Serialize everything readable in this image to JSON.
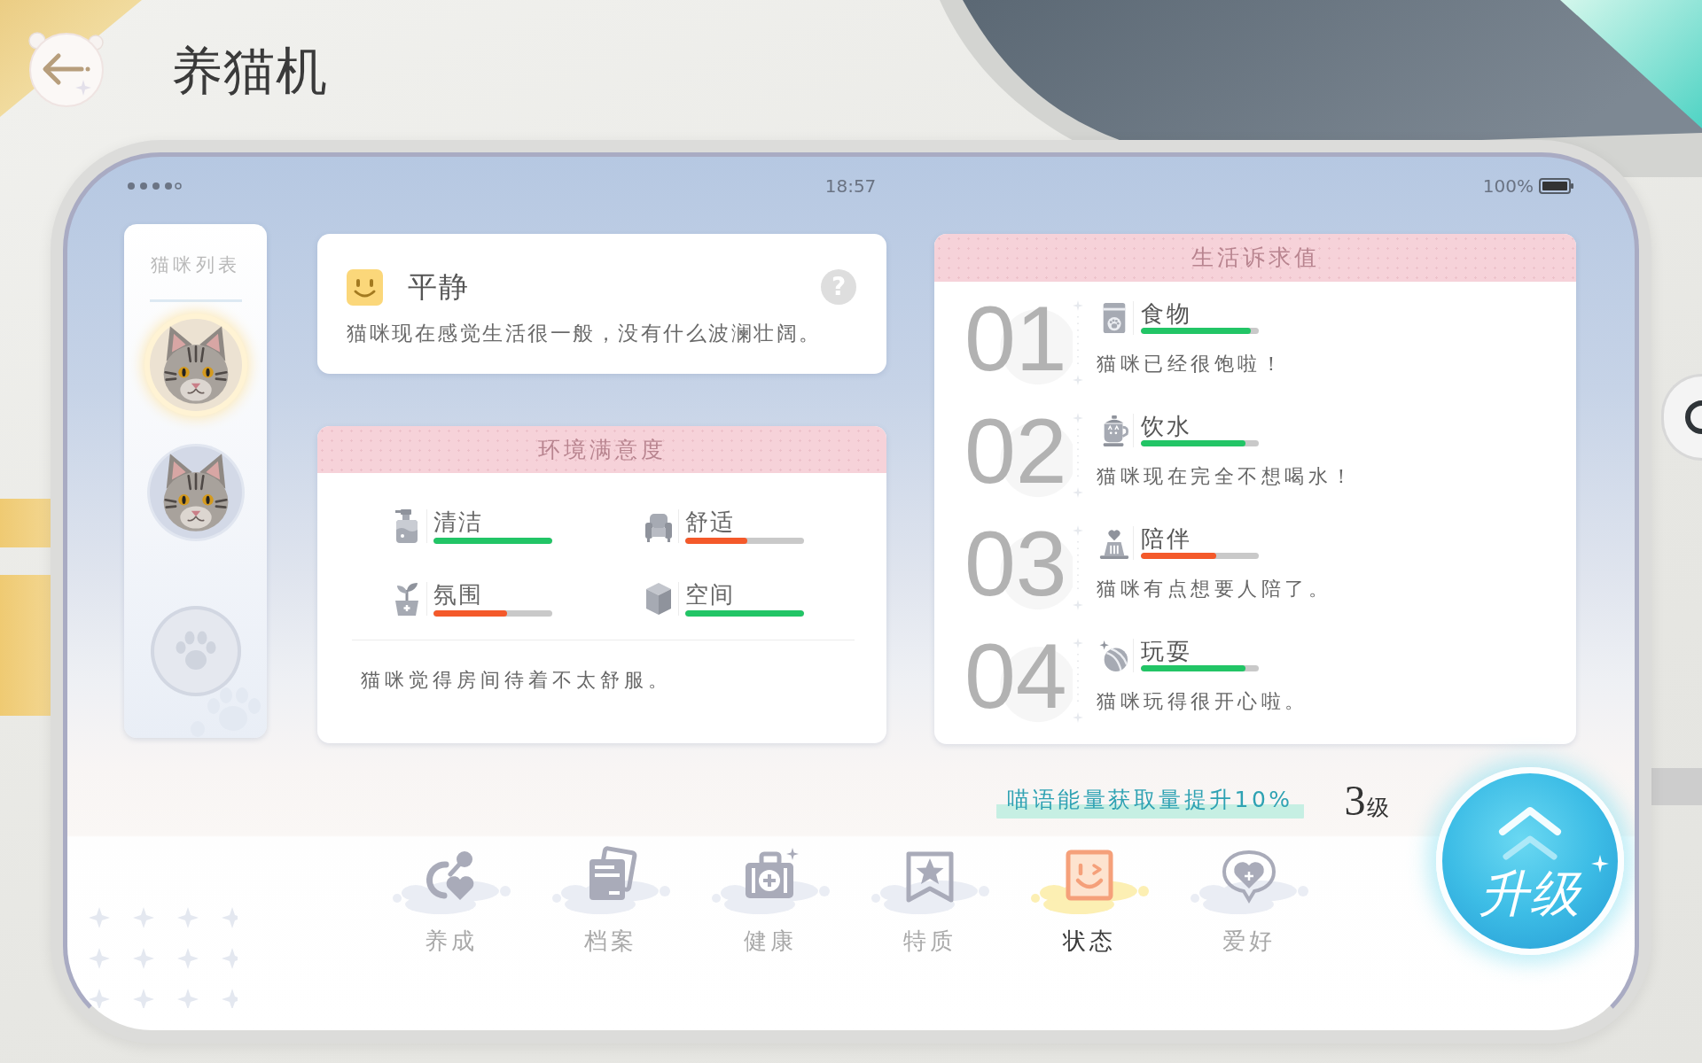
{
  "title": "养猫机",
  "status_bar": {
    "time": "18:57",
    "battery": "100%"
  },
  "cat_list": {
    "title": "猫咪列表",
    "slots": [
      {
        "kind": "cat",
        "selected": true
      },
      {
        "kind": "cat",
        "selected": false
      },
      {
        "kind": "empty",
        "selected": false
      }
    ]
  },
  "mood": {
    "title": "平静",
    "description": "猫咪现在感觉生活很一般，没有什么波澜壮阔。",
    "help": "?"
  },
  "environment": {
    "title": "环境满意度",
    "stats": [
      {
        "label": "清洁",
        "level": 1.0,
        "color": "#22c566"
      },
      {
        "label": "舒适",
        "level": 0.52,
        "color": "#f4592a"
      },
      {
        "label": "氛围",
        "level": 0.62,
        "color": "#f4592a"
      },
      {
        "label": "空间",
        "level": 1.0,
        "color": "#22c566"
      }
    ],
    "summary": "猫咪觉得房间待着不太舒服。"
  },
  "needs": {
    "title": "生活诉求值",
    "items": [
      {
        "number": "01",
        "label": "食物",
        "level": 0.93,
        "color": "#22c566",
        "description": "猫咪已经很饱啦！"
      },
      {
        "number": "02",
        "label": "饮水",
        "level": 0.89,
        "color": "#22c566",
        "description": "猫咪现在完全不想喝水！"
      },
      {
        "number": "03",
        "label": "陪伴",
        "level": 0.64,
        "color": "#f4592a",
        "description": "猫咪有点想要人陪了。"
      },
      {
        "number": "04",
        "label": "玩耍",
        "level": 0.89,
        "color": "#22c566",
        "description": "猫咪玩得很开心啦。"
      }
    ]
  },
  "bonus": "喵语能量获取量提升10%",
  "grade": {
    "number": "3",
    "unit": "级"
  },
  "upgrade_button": "升级",
  "tabs": [
    {
      "label": "养成",
      "selected": false
    },
    {
      "label": "档案",
      "selected": false
    },
    {
      "label": "健康",
      "selected": false
    },
    {
      "label": "特质",
      "selected": false
    },
    {
      "label": "状态",
      "selected": true
    },
    {
      "label": "爱好",
      "selected": false
    }
  ]
}
